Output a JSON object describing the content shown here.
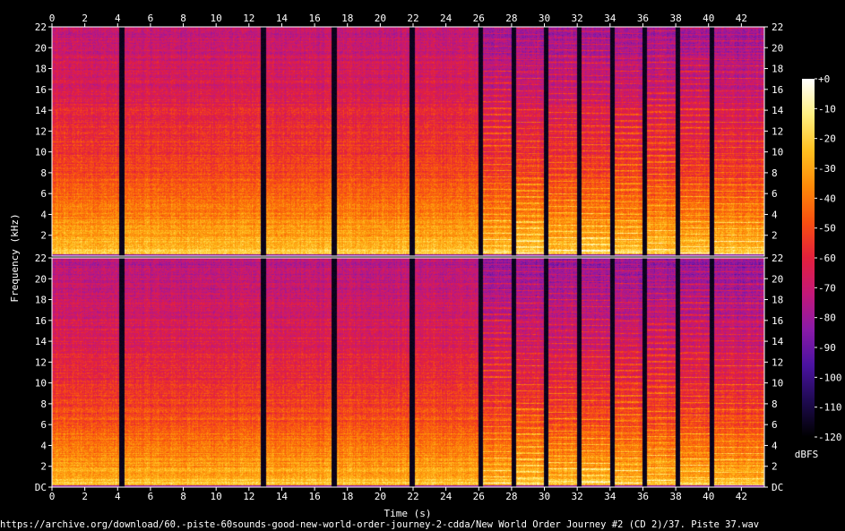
{
  "chart_data": {
    "type": "heatmap",
    "xlabel": "Time (s)",
    "ylabel": "Frequency (kHz)",
    "xlim": [
      0,
      43.4
    ],
    "ylim": [
      0,
      22
    ],
    "x_ticks": [
      "0",
      "2",
      "4",
      "6",
      "8",
      "10",
      "12",
      "14",
      "16",
      "18",
      "20",
      "22",
      "24",
      "26",
      "28",
      "30",
      "32",
      "34",
      "36",
      "38",
      "40",
      "42"
    ],
    "y_ticks": [
      "DC",
      "2",
      "4",
      "6",
      "8",
      "10",
      "12",
      "14",
      "16",
      "18",
      "20",
      "22"
    ],
    "channels": 2,
    "gap_times_s": [
      4.25,
      12.85,
      17.15,
      21.9,
      26.1,
      28.1,
      30.1,
      32.1,
      34.1,
      36.1,
      38.1,
      40.2
    ],
    "colorbar": {
      "label": "dBFS",
      "ticks": [
        "+0",
        "-10",
        "-20",
        "-30",
        "-40",
        "-50",
        "-60",
        "-70",
        "-80",
        "-90",
        "-100",
        "-110",
        "-120"
      ],
      "range_dbfs": [
        -120,
        0
      ],
      "colors": [
        "#000000",
        "#1e0a50",
        "#4a12a0",
        "#8a1aa8",
        "#c41878",
        "#e4203c",
        "#f85010",
        "#fd8a08",
        "#ffc020",
        "#ffef80",
        "#ffffff"
      ]
    }
  },
  "footer": {
    "source": "https://archive.org/download/60.-piste-60sounds-good-new-world-order-journey-2-cdda/New World Order Journey #2 (CD 2)/37. Piste 37.wav"
  }
}
